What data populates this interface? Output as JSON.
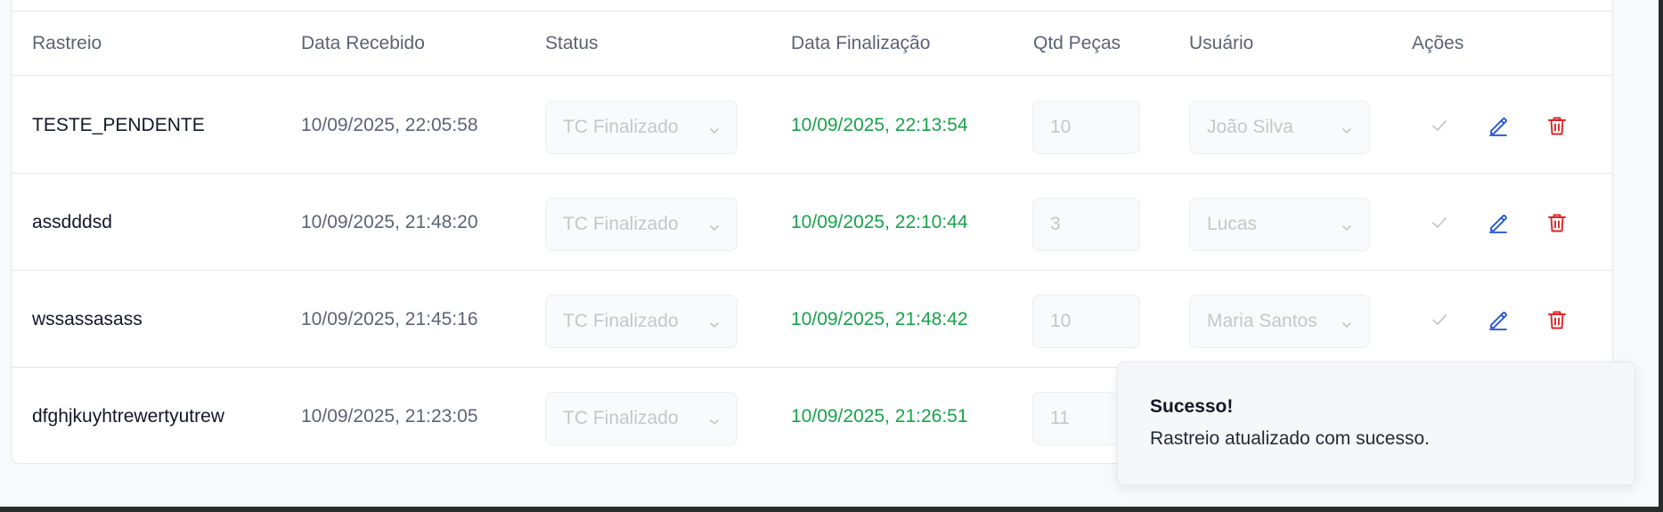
{
  "table": {
    "headers": {
      "rastreio": "Rastreio",
      "data_recebido": "Data Recebido",
      "status": "Status",
      "data_finalizacao": "Data Finalização",
      "qtd_pecas": "Qtd Peças",
      "usuario": "Usuário",
      "acoes": "Ações"
    },
    "rows": [
      {
        "rastreio": "TESTE_PENDENTE",
        "data_recebido": "10/09/2025, 22:05:58",
        "status": "TC Finalizado",
        "data_finalizacao": "10/09/2025, 22:13:54",
        "qtd": "10",
        "usuario": "João Silva"
      },
      {
        "rastreio": "assdddsd",
        "data_recebido": "10/09/2025, 21:48:20",
        "status": "TC Finalizado",
        "data_finalizacao": "10/09/2025, 22:10:44",
        "qtd": "3",
        "usuario": "Lucas"
      },
      {
        "rastreio": "wssassasass",
        "data_recebido": "10/09/2025, 21:45:16",
        "status": "TC Finalizado",
        "data_finalizacao": "10/09/2025, 21:48:42",
        "qtd": "10",
        "usuario": "Maria Santos"
      },
      {
        "rastreio": "dfghjkuyhtrewertyutrew",
        "data_recebido": "10/09/2025, 21:23:05",
        "status": "TC Finalizado",
        "data_finalizacao": "10/09/2025, 21:26:51",
        "qtd": "11",
        "usuario": ""
      }
    ]
  },
  "toast": {
    "title": "Sucesso!",
    "message": "Rastreio atualizado com sucesso."
  },
  "colors": {
    "success_text": "#16a34a",
    "edit_icon": "#1d4ed8",
    "delete_icon": "#dc2626",
    "check_icon": "#c3c7ce"
  },
  "icons": {
    "confirm": "check-icon",
    "edit": "pencil-icon",
    "delete": "trash-icon",
    "select": "chevron-down-icon"
  }
}
